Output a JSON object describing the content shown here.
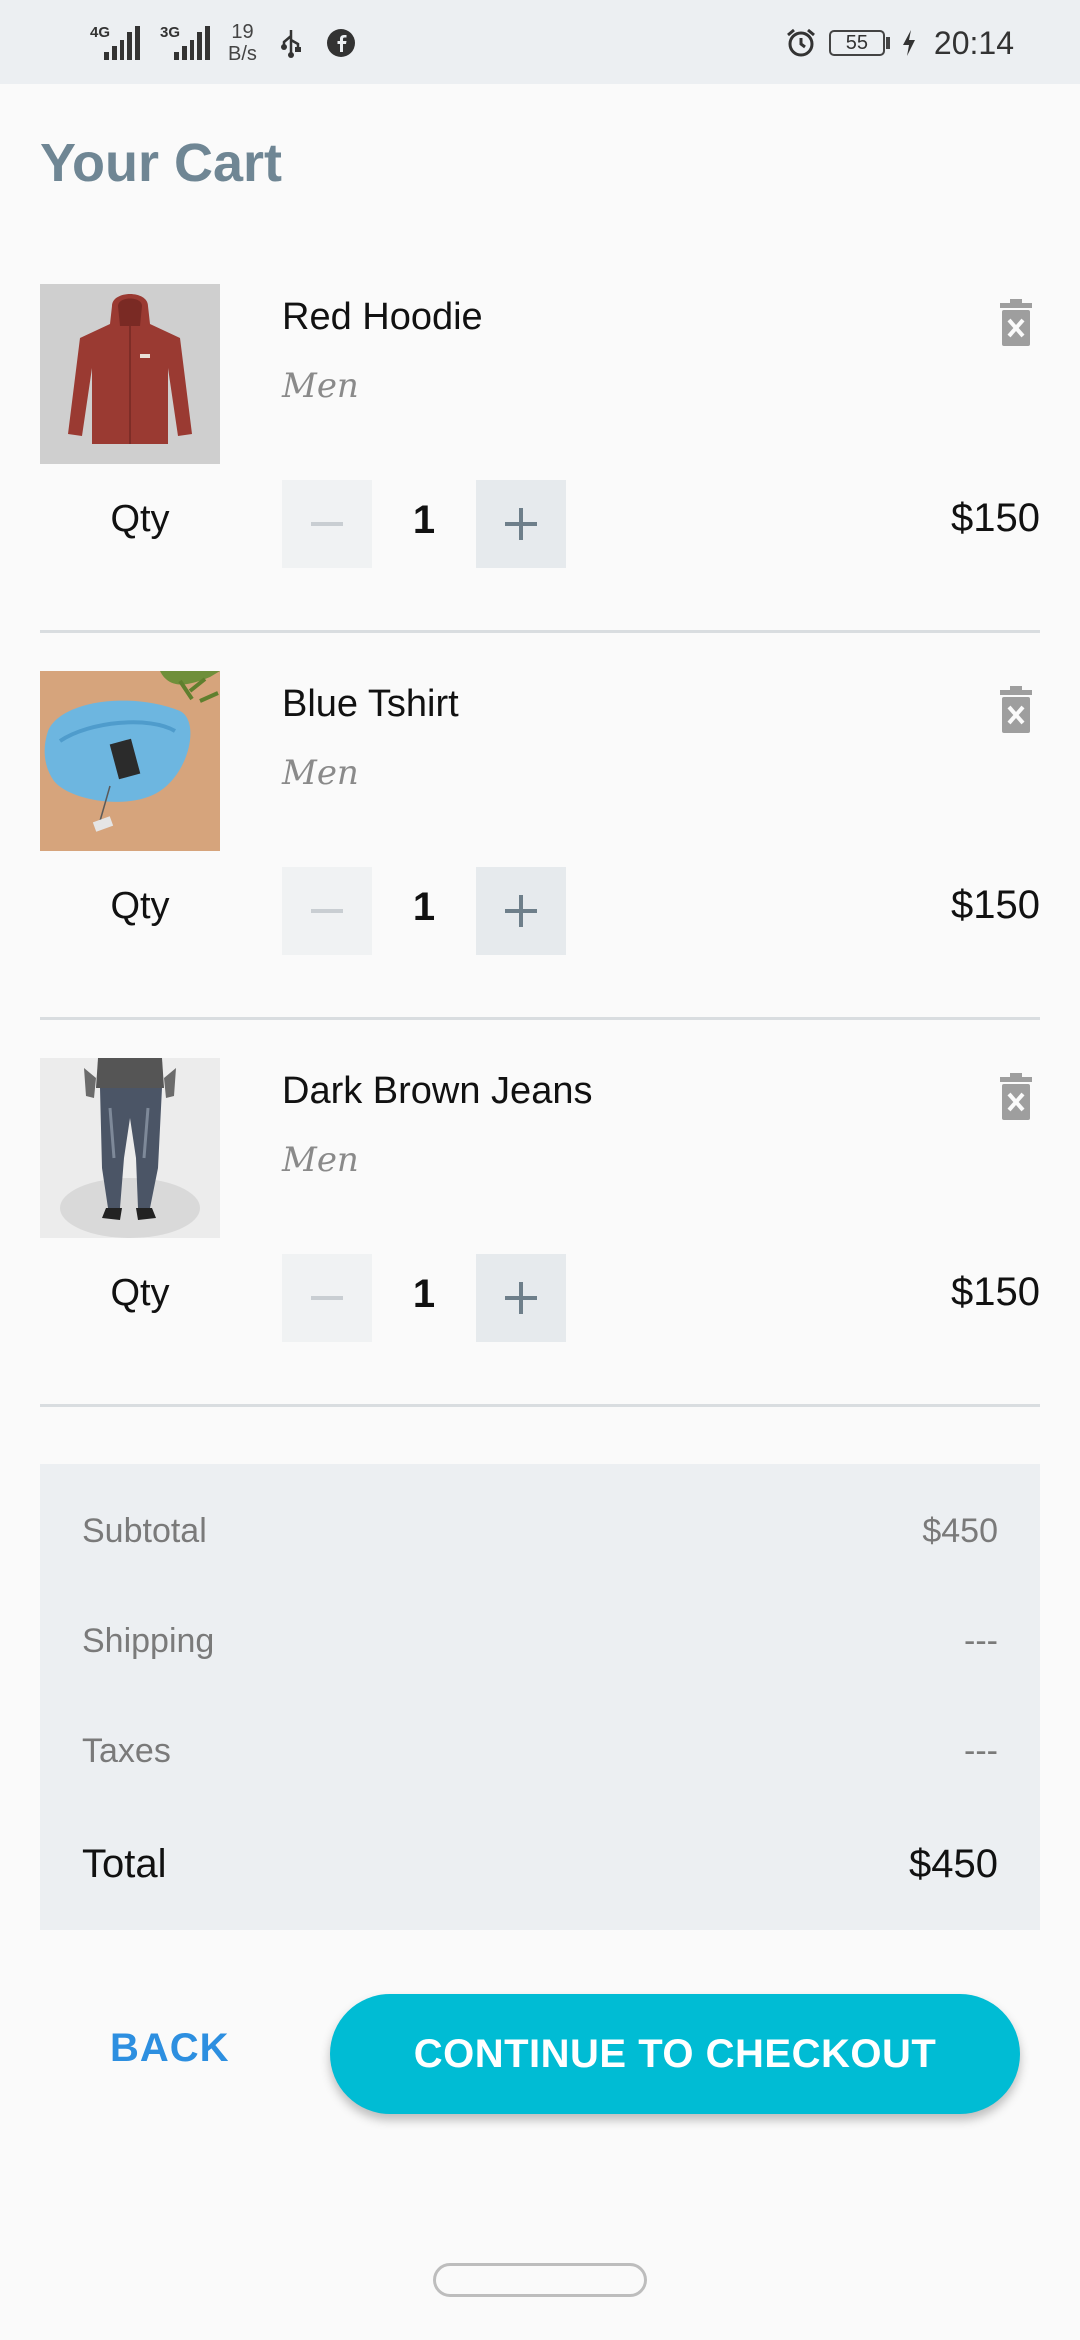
{
  "status_bar": {
    "net1": "4G",
    "net2": "3G",
    "speed_value": "19",
    "speed_unit": "B/s",
    "battery": "55",
    "time": "20:14"
  },
  "page": {
    "title": "Your Cart"
  },
  "cart": {
    "qty_label": "Qty",
    "items": [
      {
        "name": "Red Hoodie",
        "category": "Men",
        "quantity": "1",
        "price": "$150",
        "image": "red-hoodie"
      },
      {
        "name": "Blue Tshirt",
        "category": "Men",
        "quantity": "1",
        "price": "$150",
        "image": "blue-tshirt"
      },
      {
        "name": "Dark Brown Jeans",
        "category": "Men",
        "quantity": "1",
        "price": "$150",
        "image": "jeans"
      }
    ]
  },
  "summary": {
    "subtotal_label": "Subtotal",
    "subtotal_value": "$450",
    "shipping_label": "Shipping",
    "shipping_value": "---",
    "taxes_label": "Taxes",
    "taxes_value": "---",
    "total_label": "Total",
    "total_value": "$450"
  },
  "actions": {
    "back_label": "BACK",
    "checkout_label": "CONTINUE TO CHECKOUT"
  },
  "colors": {
    "accent": "#00bcd4",
    "back_link": "#2d8fe0",
    "title": "#6f8694",
    "summary_bg": "#eceff2"
  },
  "icons": [
    "signal-icon",
    "usb-icon",
    "facebook-icon",
    "alarm-icon",
    "battery-icon",
    "charging-icon",
    "trash-icon",
    "minus-icon",
    "plus-icon"
  ]
}
